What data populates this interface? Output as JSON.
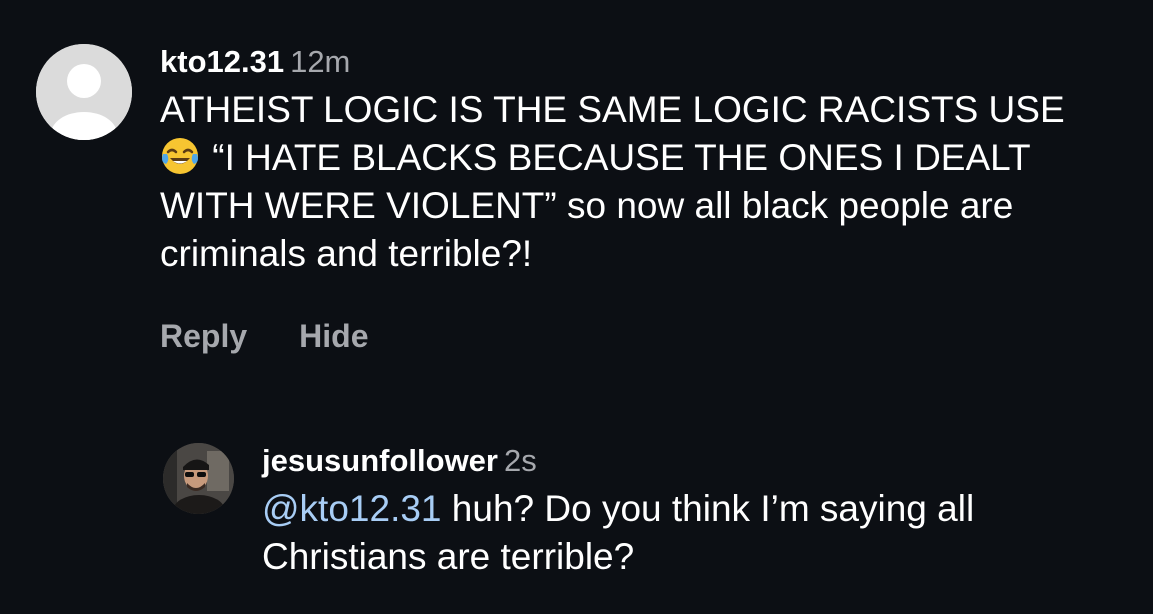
{
  "comments": [
    {
      "username": "kto12.31",
      "time": "12m",
      "text_line1": "ATHEIST LOGIC IS THE SAME LOGIC RACISTS USE",
      "emoji": "face-with-tears-of-joy-icon",
      "text_rest": " “I HATE BLACKS BECAUSE THE ONES I DEALT WITH WERE VIOLENT” so now all black people are criminals and terrible?!",
      "reply_label": "Reply",
      "hide_label": "Hide"
    },
    {
      "username": "jesusunfollower",
      "time": "2s",
      "mention": "@kto12.31",
      "text": " huh? Do you think I’m saying all Christians are terrible?"
    }
  ],
  "colors": {
    "background": "#0c0f14",
    "text": "#ffffff",
    "muted": "#a6a8ad",
    "mention": "#a8cdf5"
  }
}
